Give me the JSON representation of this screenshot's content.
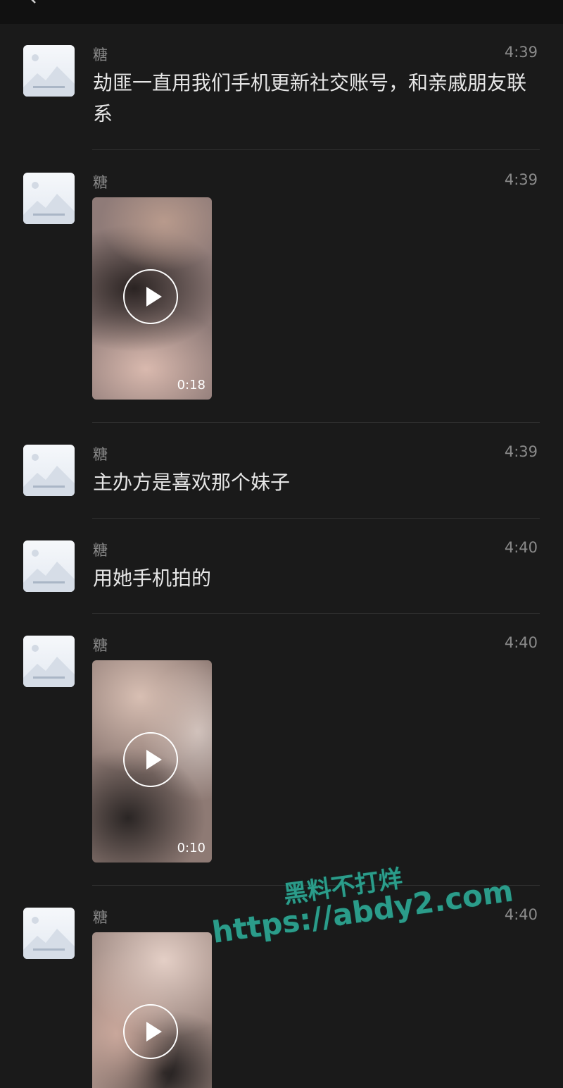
{
  "messages": [
    {
      "sender": "糖",
      "time": "4:39",
      "type": "text",
      "text": "劫匪一直用我们手机更新社交账号，和亲戚朋友联系"
    },
    {
      "sender": "糖",
      "time": "4:39",
      "type": "video",
      "duration": "0:18"
    },
    {
      "sender": "糖",
      "time": "4:39",
      "type": "text",
      "text": "主办方是喜欢那个妹子"
    },
    {
      "sender": "糖",
      "time": "4:40",
      "type": "text",
      "text": "用她手机拍的"
    },
    {
      "sender": "糖",
      "time": "4:40",
      "type": "video",
      "duration": "0:10"
    },
    {
      "sender": "糖",
      "time": "4:40",
      "type": "video",
      "duration": ""
    }
  ],
  "watermark": {
    "line1": "黑料不打烊",
    "line2": "https://abdy2.com"
  },
  "icons": {
    "back": "chevron-left-icon",
    "play": "play-icon",
    "avatar": "image-placeholder-icon"
  },
  "colors": {
    "background": "#1a1a1a",
    "text": "#e6e6e6",
    "meta": "#8a8a8a",
    "watermark": "#2b9c8a"
  }
}
